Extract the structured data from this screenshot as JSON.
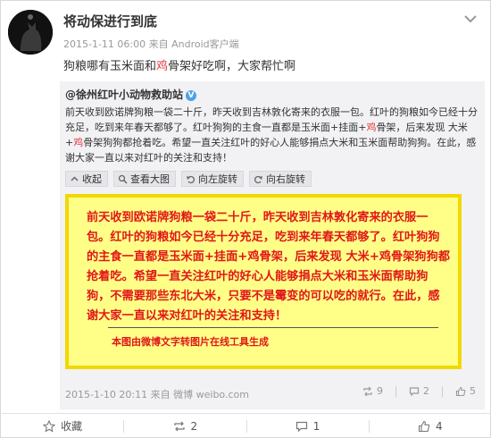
{
  "user": {
    "name": "将动保进行到底",
    "timestamp": "2015-1-11 06:00",
    "source": "来自 Android客户端"
  },
  "post": {
    "part1": "狗粮哪有玉米面和",
    "highlight": "鸡",
    "part2": "骨架好吃啊，大家帮忙啊"
  },
  "original": {
    "author": "@徐州红叶小动物救助站",
    "text_a": "前天收到欧诺牌狗粮一袋二十斤，昨天收到吉林敦化寄来的衣服一包。红叶的狗粮如今已经十分充足，吃到来年春天都够了。红叶狗狗的主食一直都是玉米面+挂面+",
    "hl1": "鸡",
    "text_b": "骨架，后来发现 大米+",
    "hl2": "鸡",
    "text_c": "骨架狗狗都抢着吃。希望一直关注红叶的好心人能够捐点大米和玉米面帮助狗狗。在此，感谢大家一直以来对红叶的关注和支持！",
    "timestamp": "2015-1-10 20:11",
    "source": "来自 微博 weibo.com",
    "reposts": "9",
    "comments": "2",
    "likes": "5"
  },
  "tools": {
    "collapse": "收起",
    "view_large": "查看大图",
    "rotate_left": "向左旋转",
    "rotate_right": "向右旋转"
  },
  "image": {
    "text": "前天收到欧诺牌狗粮一袋二十斤，昨天收到吉林敦化寄来的衣服一包。红叶的狗粮如今已经十分充足，吃到来年春天都够了。红叶狗狗的主食一直都是玉米面+挂面+鸡骨架，后来发现 大米+鸡骨架狗狗都抢着吃。希望一直关注红叶的好心人能够捐点大米和玉米面帮助狗狗，不需要那些东北大米，只要不是霉变的可以吃的就行。在此，感谢大家一直以来对红叶的关注和支持！",
    "footer": "本图由微博文字转图片在线工具生成"
  },
  "actions": {
    "favorite": "收藏",
    "repost": "2",
    "comment": "1",
    "like": "4"
  },
  "colors": {
    "accent_red": "#e4393c",
    "image_bg": "#ffff88",
    "image_border": "#f0d800",
    "image_text": "#e01818",
    "repost_bg": "#f2f2f5"
  }
}
